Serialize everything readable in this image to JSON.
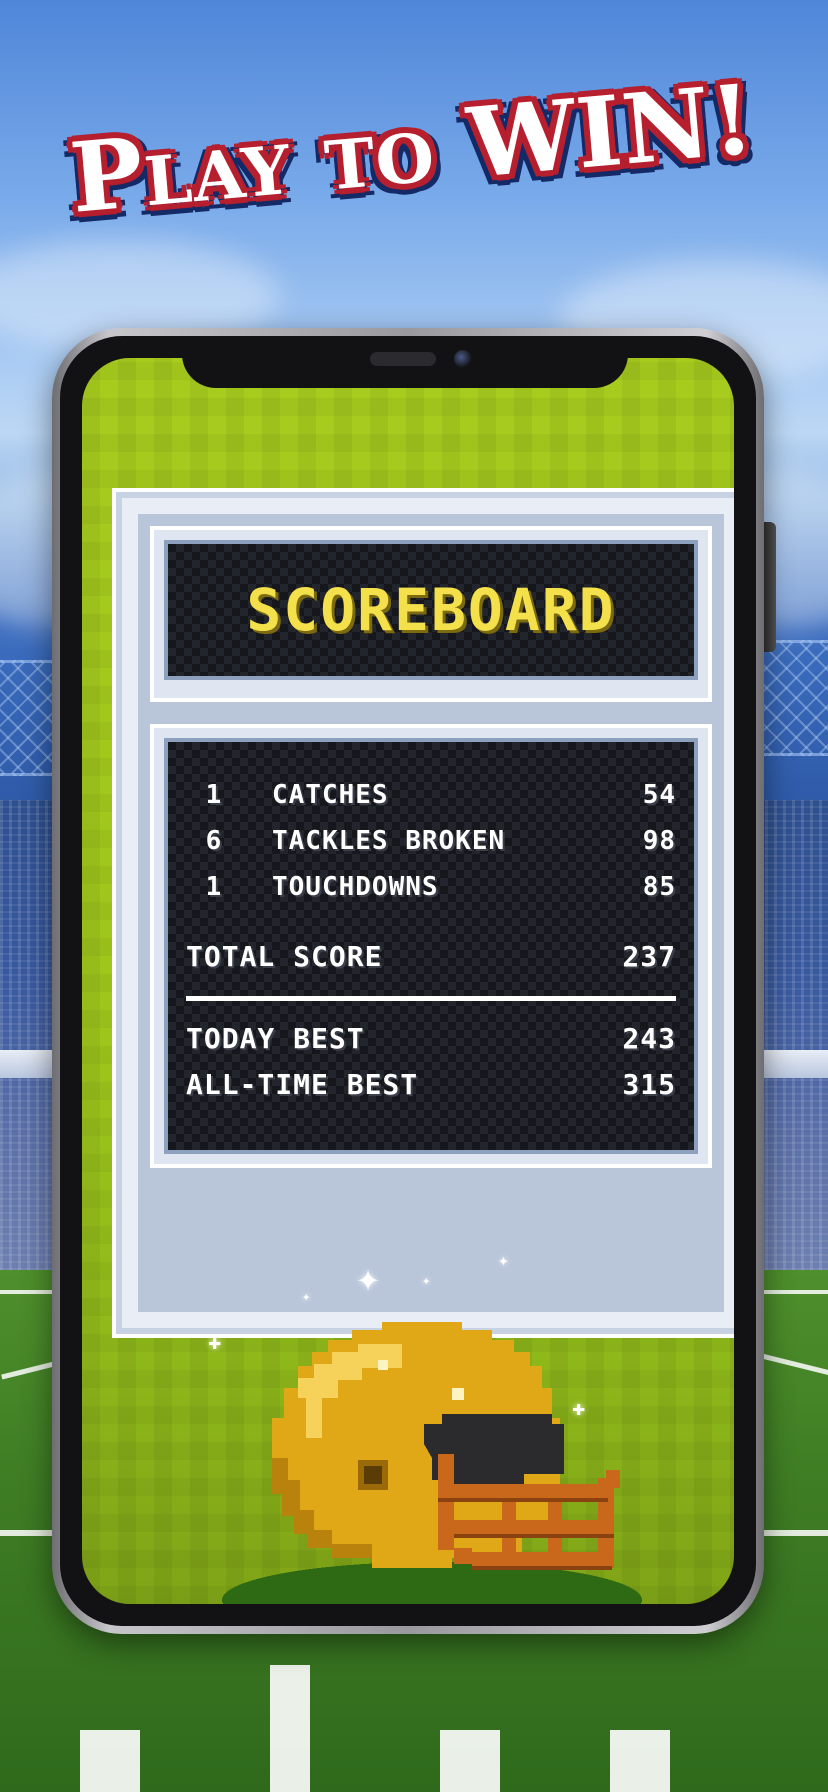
{
  "title": "Play to WIN!",
  "scoreboard": {
    "heading": "SCOREBOARD",
    "stats": [
      {
        "count": "1",
        "label": "CATCHES",
        "value": "54"
      },
      {
        "count": "6",
        "label": "TACKLES BROKEN",
        "value": "98"
      },
      {
        "count": "1",
        "label": "TOUCHDOWNS",
        "value": "85"
      }
    ],
    "total": {
      "label": "TOTAL SCORE",
      "value": "237"
    },
    "today_best": {
      "label": "TODAY BEST",
      "value": "243"
    },
    "all_time_best": {
      "label": "ALL-TIME BEST",
      "value": "315"
    }
  },
  "icons": {
    "helmet": "football-helmet-icon",
    "sparkle": "sparkle-icon"
  },
  "colors": {
    "title_outline": "#b51f2e",
    "title_shadow": "#142a66",
    "scoreboard_heading": "#f4e04a",
    "screen_green": "#a8cc1e",
    "helmet_gold": "#e0a816",
    "facemask_orange": "#c9681a"
  }
}
